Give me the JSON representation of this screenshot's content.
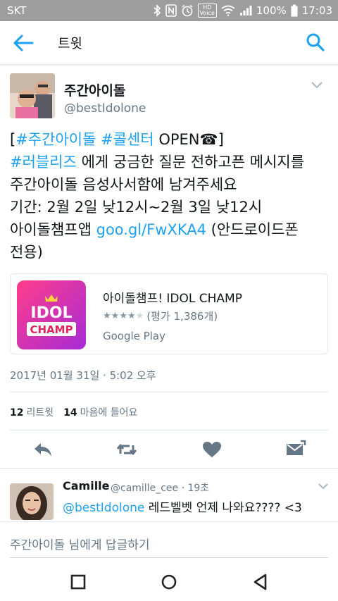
{
  "status_bar": {
    "carrier": "SKT",
    "battery": "100%",
    "time": "17:03",
    "hd_top": "HD",
    "hd_bottom": "Voice"
  },
  "app_bar": {
    "title": "트윗"
  },
  "tweet": {
    "author_name": "주간아이돌",
    "author_handle": "@bestIdolone",
    "lines": [
      [
        {
          "text": "[",
          "link": false
        },
        {
          "text": "#주간아이돌",
          "link": true
        },
        {
          "text": " ",
          "link": false
        },
        {
          "text": "#콜센터",
          "link": true
        },
        {
          "text": " OPEN☎]",
          "link": false
        }
      ],
      [
        {
          "text": "#러블리즈",
          "link": true
        },
        {
          "text": " 에게 궁금한 질문 전하고픈 메시지를",
          "link": false
        }
      ],
      [
        {
          "text": "주간아이돌 음성사서함에 남겨주세요",
          "link": false
        }
      ],
      [
        {
          "text": "기간: 2월 2일 낮12시~2월 3일 낮12시",
          "link": false
        }
      ],
      [
        {
          "text": "아이돌챔프앱 ",
          "link": false
        },
        {
          "text": "goo.gl/FwXKA4",
          "link": true
        },
        {
          "text": " (안드로이드폰",
          "link": false
        }
      ],
      [
        {
          "text": "전용)",
          "link": false
        }
      ]
    ],
    "card": {
      "title": "아이돌챔프! IDOL CHAMP",
      "rating_stars": 4,
      "rating_text": "(평가 1,386개)",
      "source": "Google Play",
      "logo_line1": "IDOL",
      "logo_line2": "CHAMP"
    },
    "timestamp": "2017년 01월 31일 · 5:02 오후",
    "retweet_count": "12",
    "retweet_label": "리트윗",
    "like_count": "14",
    "like_label": "마음에 들어요"
  },
  "reply": {
    "name": "Camille",
    "meta": "@camille_cee · 19초",
    "mention": "@bestIdolone",
    "text": " 레드벨벳 언제 나와요???? <3"
  },
  "compose": {
    "placeholder": "주간아이돌 님에게 답글하기"
  },
  "colors": {
    "accent": "#1da1f2",
    "secondary_text": "#657786",
    "status_bar": "#9e9e9e",
    "action_icon": "#657786"
  }
}
